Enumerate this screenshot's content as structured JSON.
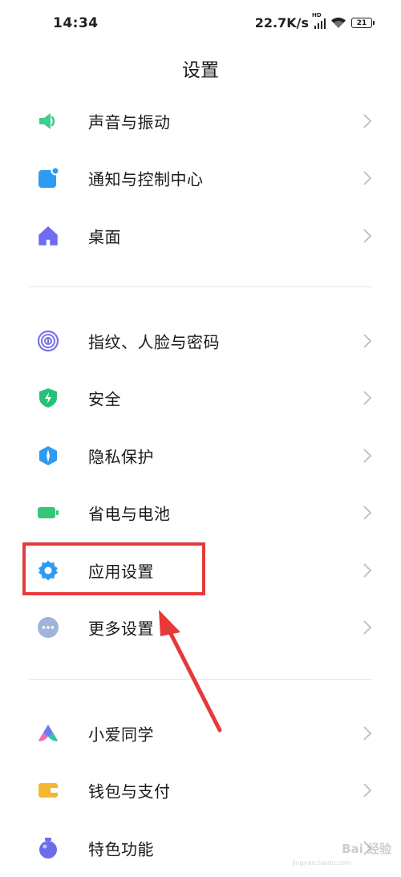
{
  "status_bar": {
    "time": "14:34",
    "net_speed": "22.7K/s",
    "network_badge": "HD",
    "battery": "21"
  },
  "header": {
    "title": "设置"
  },
  "groups": [
    {
      "items": [
        {
          "label": "声音与振动",
          "icon": "speaker-icon",
          "color": "#3ccf8e"
        },
        {
          "label": "通知与控制中心",
          "icon": "notification-icon",
          "color": "#2f9bf0"
        },
        {
          "label": "桌面",
          "icon": "home-icon",
          "color": "#6e6cf0"
        }
      ]
    },
    {
      "items": [
        {
          "label": "指纹、人脸与密码",
          "icon": "fingerprint-icon",
          "color": "#7a72e6"
        },
        {
          "label": "安全",
          "icon": "shield-icon",
          "color": "#26c07a"
        },
        {
          "label": "隐私保护",
          "icon": "privacy-icon",
          "color": "#2f9bf0"
        },
        {
          "label": "省电与电池",
          "icon": "battery-icon",
          "color": "#34c77b"
        },
        {
          "label": "应用设置",
          "icon": "gear-icon",
          "color": "#2f9bf0"
        },
        {
          "label": "更多设置",
          "icon": "more-icon",
          "color": "#9fb4d8"
        }
      ]
    },
    {
      "items": [
        {
          "label": "小爱同学",
          "icon": "xiaoai-icon",
          "color": "#6b7cf0"
        },
        {
          "label": "钱包与支付",
          "icon": "wallet-icon",
          "color": "#f5b731"
        },
        {
          "label": "特色功能",
          "icon": "feature-icon",
          "color": "#6b6ee8"
        }
      ]
    }
  ],
  "annotation": {
    "color": "#e6393a"
  },
  "watermark": {
    "text": "Bai 经验",
    "sub": "jingyan.baidu.com"
  }
}
